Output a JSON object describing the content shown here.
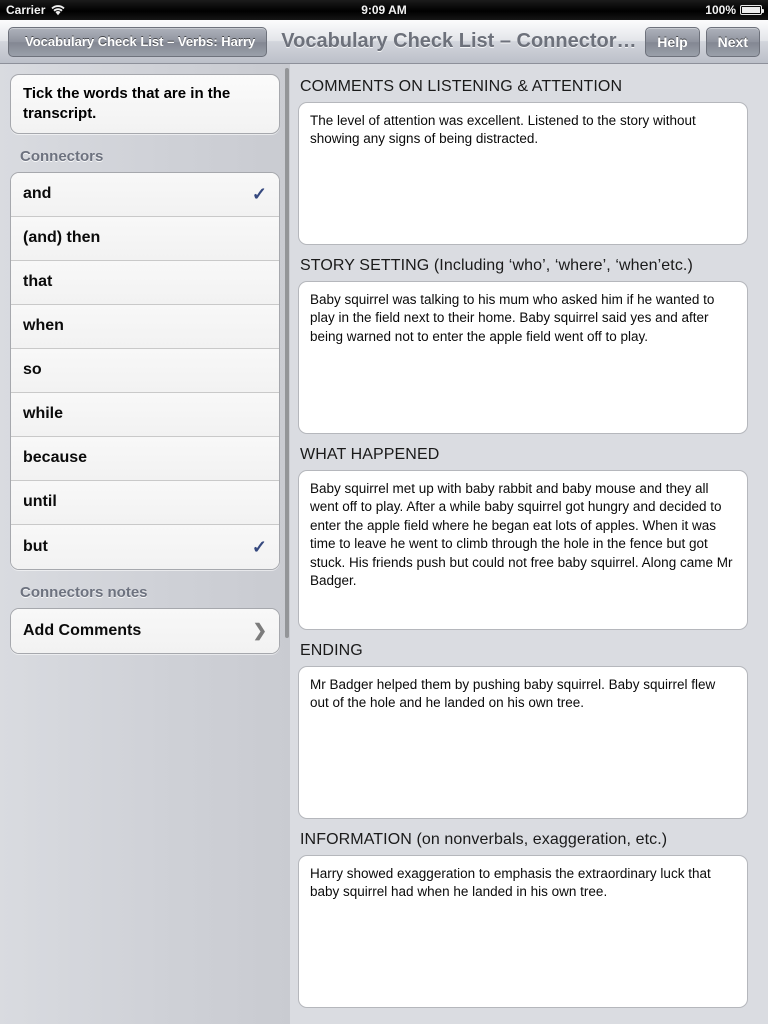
{
  "status_bar": {
    "carrier": "Carrier",
    "wifi_icon": "wifi-icon",
    "time": "9:09 AM",
    "battery_percent": "100%",
    "battery_icon": "battery-full-icon"
  },
  "nav_bar": {
    "back_label": "Vocabulary Check List – Verbs: Harry",
    "title": "Vocabulary Check List – Connectors:…",
    "help_label": "Help",
    "next_label": "Next"
  },
  "sidebar": {
    "instruction": "Tick the words that are in the transcript.",
    "list_header": "Connectors",
    "items": [
      {
        "label": "and",
        "checked": true
      },
      {
        "label": "(and) then",
        "checked": false
      },
      {
        "label": "that",
        "checked": false
      },
      {
        "label": "when",
        "checked": false
      },
      {
        "label": "so",
        "checked": false
      },
      {
        "label": "while",
        "checked": false
      },
      {
        "label": "because",
        "checked": false
      },
      {
        "label": "until",
        "checked": false
      },
      {
        "label": "but",
        "checked": true
      }
    ],
    "notes_header": "Connectors notes",
    "notes_row_label": "Add Comments",
    "notes_row_chevron": "chevron-right-icon",
    "check_glyph": "✓",
    "check_color": "#36497f"
  },
  "detail": {
    "sections": [
      {
        "title": "COMMENTS ON LISTENING & ATTENTION",
        "text": "The level of attention was excellent. Listened to the story without showing any signs of being distracted."
      },
      {
        "title": "STORY SETTING (Including ‘who’, ‘where’, ‘when’etc.)",
        "text": "Baby squirrel was talking to his mum who asked him if he wanted to play in the field next to their home. Baby squirrel said yes and after being warned not to enter the apple field went off to play."
      },
      {
        "title": "WHAT HAPPENED",
        "text": "Baby squirrel met up with baby rabbit and baby mouse and they all went off to play. After a while baby squirrel got hungry and decided to enter the apple field where he began eat lots of apples. When it was time to leave he went to climb through the hole in the fence but got stuck. His friends push but could not free baby squirrel. Along came Mr Badger."
      },
      {
        "title": "ENDING",
        "text": "Mr Badger helped them by pushing baby squirrel. Baby squirrel flew out of the hole and he landed on his own tree."
      },
      {
        "title": "INFORMATION (on nonverbals, exaggeration, etc.)",
        "text": "Harry showed exaggeration to emphasis the extraordinary luck that baby squirrel had when he landed in his own tree."
      }
    ]
  }
}
